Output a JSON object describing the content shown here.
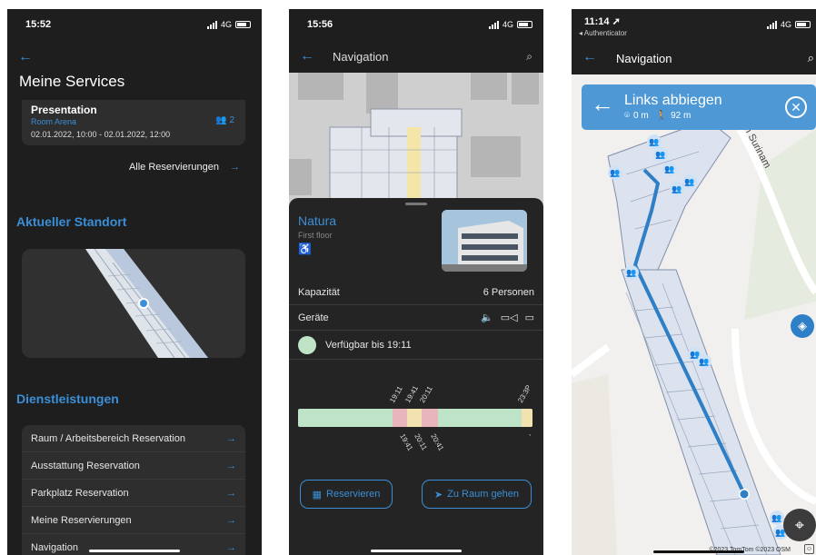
{
  "screen1": {
    "time": "15:52",
    "network": "4G",
    "title": "Meine Services",
    "reservation": {
      "title": "Presentation",
      "location": "Room Arena",
      "participants": "2",
      "datetime": "02.01.2022, 10:00 - 02.01.2022, 12:00"
    },
    "all_reservations": "Alle Reservierungen",
    "current_location_heading": "Aktueller Standort",
    "services_heading": "Dienstleistungen",
    "services": [
      "Raum / Arbeitsbereich Reservation",
      "Ausstattung Reservation",
      "Parkplatz Reservation",
      "Meine Reservierungen",
      "Navigation"
    ]
  },
  "screen2": {
    "time": "15:56",
    "network": "4G",
    "title": "Navigation",
    "room": {
      "name": "Natura",
      "floor": "First floor"
    },
    "capacity_label": "Kapazität",
    "capacity_value": "6 Personen",
    "devices_label": "Geräte",
    "availability": "Verfügbar bis 19:11",
    "timeline_top": [
      "19:11",
      "19:41",
      "20:11",
      "23:3P"
    ],
    "timeline_bottom": [
      "19:41",
      "20:11",
      "20:41",
      ","
    ],
    "reserve_button": "Reservieren",
    "go_button": "Zu Raum gehen"
  },
  "screen3": {
    "time": "11:14",
    "back_app": "◂ Authenticator",
    "network": "4G",
    "title": "Navigation",
    "instruction": "Links abbiegen",
    "distance": "0 m",
    "walk": "92 m",
    "street": "Im Surinam",
    "attribution": "©2023 TomTom ©2023 OSM"
  },
  "colors": {
    "accent": "#3a8fd8",
    "dark_bg": "#1e1e1e",
    "card_bg": "#2e2e2e",
    "avail": "#bfe3c6",
    "busy": "#e9b5bd",
    "tentative": "#f1e2b0"
  }
}
